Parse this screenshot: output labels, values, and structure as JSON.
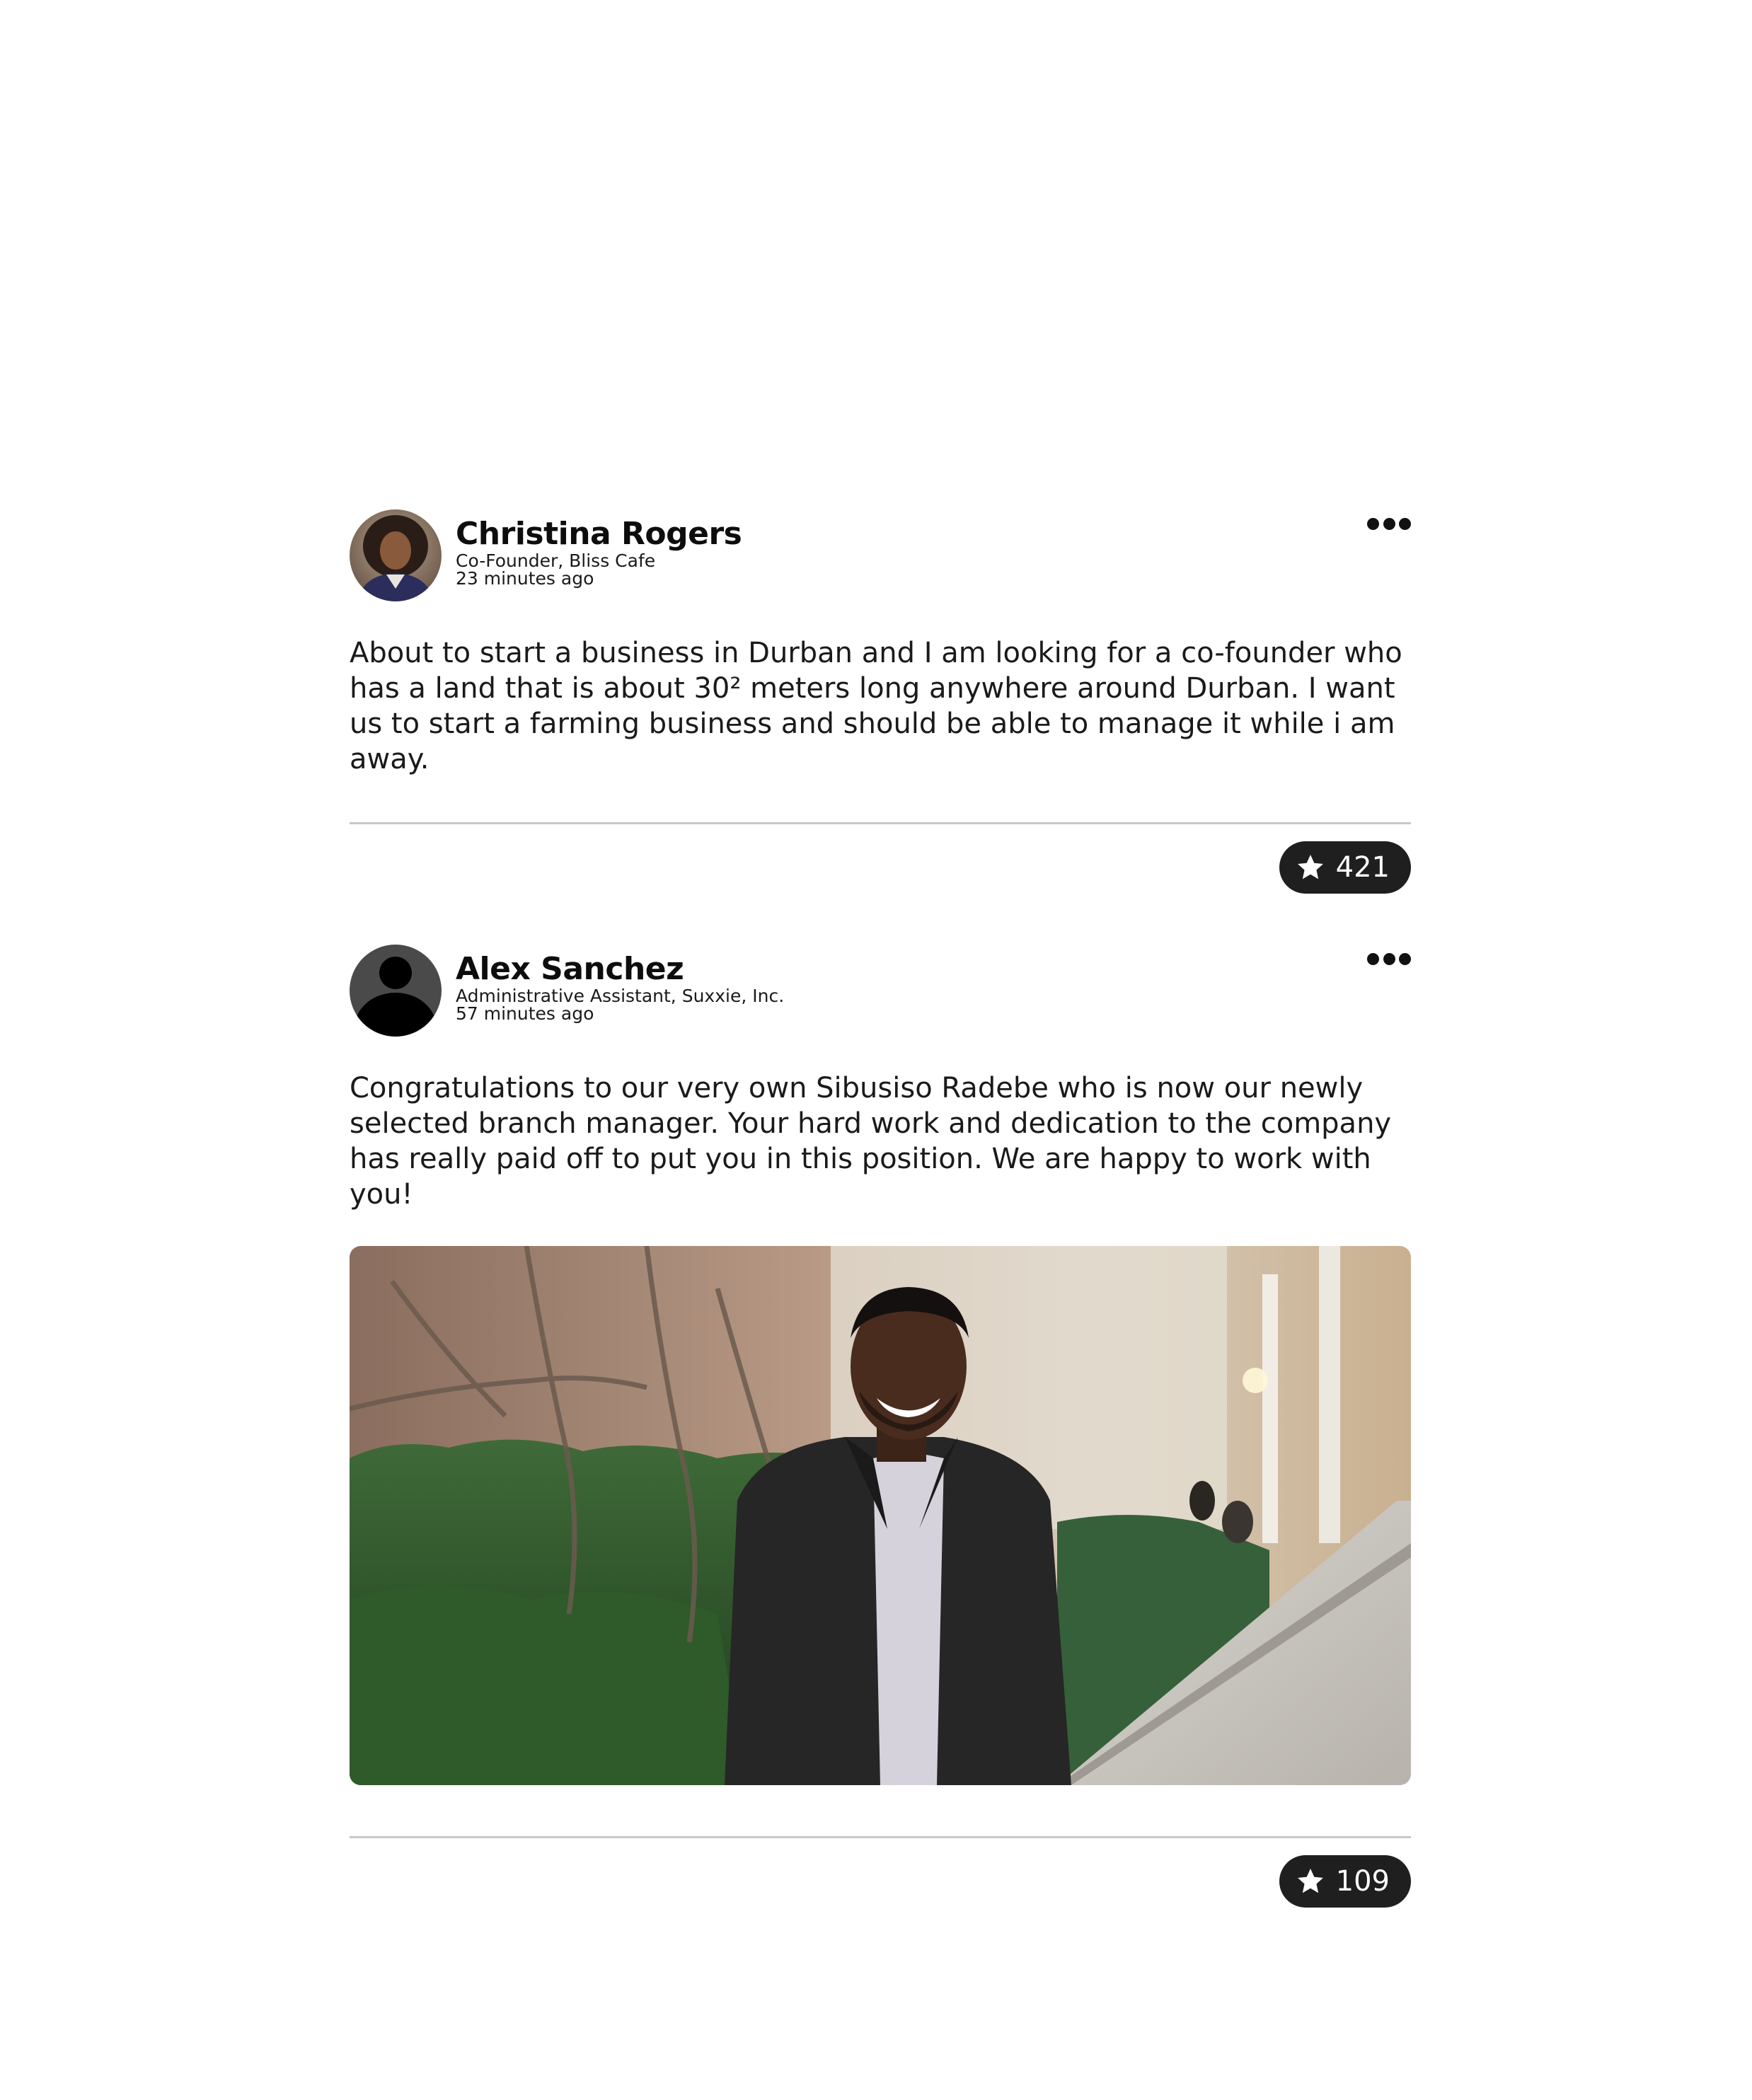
{
  "posts": [
    {
      "author": {
        "name": "Christina Rogers",
        "title": "Co-Founder, Bliss Cafe",
        "time": "23 minutes ago"
      },
      "text": "About to start a business in Durban and I am looking for a co-founder who has a land that is about 30² meters long anywhere around Durban. I want us to start a farming business and should be able to manage it while i am away.",
      "stars": "421",
      "avatar_icon": "user-photo-avatar",
      "more_icon": "more-horizontal-icon",
      "star_icon": "star-icon"
    },
    {
      "author": {
        "name": "Alex Sanchez",
        "title": "Administrative Assistant, Suxxie, Inc.",
        "time": "57 minutes ago"
      },
      "text": "Congratulations to our very own Sibusiso Radebe who is now our newly selected branch manager. Your hard work and dedication to the company has really paid off to put you in this position. We are happy to work with you!",
      "stars": "109",
      "avatar_icon": "default-user-avatar",
      "more_icon": "more-horizontal-icon",
      "star_icon": "star-icon",
      "image": "photo of a smiling man in a dark suit outdoors"
    }
  ],
  "colors": {
    "badge_bg": "#1f1f1f",
    "badge_text": "#ffffff",
    "divider": "#c8c8c8",
    "text": "#1a1a1a"
  }
}
